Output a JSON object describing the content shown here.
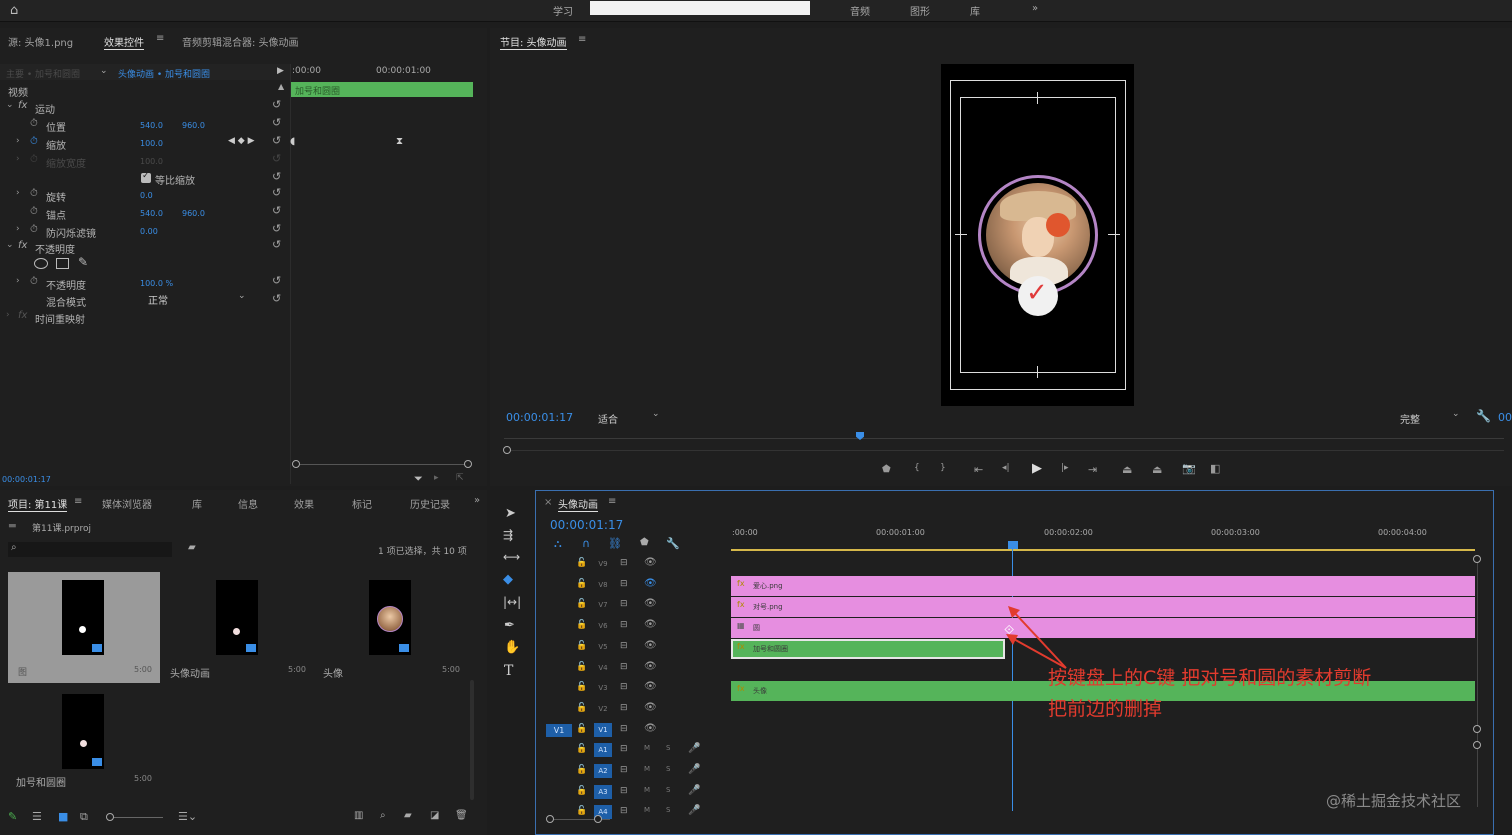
{
  "topbar": {
    "workspaces": [
      "学习",
      "音频",
      "图形",
      "库"
    ],
    "more": "»"
  },
  "effect_panel": {
    "tabs": [
      "源: 头像1.png",
      "效果控件",
      "音频剪辑混合器: 头像动画"
    ],
    "menu_icon": "≡",
    "source_path": "主要 • 加号和圆圈",
    "sequence_path": "头像动画 • 加号和圆圈",
    "ruler": {
      "start": ":00:00",
      "mark": "00:00:01:00"
    },
    "clip_name": "加号和圆圈",
    "video_label": "视频",
    "groups": [
      {
        "name": "运动",
        "fx": "fx"
      },
      {
        "name": "不透明度",
        "fx": "fx"
      },
      {
        "name": "时间重映射",
        "fx": "fx"
      }
    ],
    "props": {
      "position": {
        "label": "位置",
        "x": "540.0",
        "y": "960.0"
      },
      "scale": {
        "label": "缩放",
        "value": "100.0"
      },
      "scale_width": {
        "label": "缩放宽度",
        "value": "100.0"
      },
      "uniform_scale": "等比缩放",
      "rotation": {
        "label": "旋转",
        "value": "0.0"
      },
      "anchor": {
        "label": "锚点",
        "x": "540.0",
        "y": "960.0"
      },
      "antiflicker": {
        "label": "防闪烁滤镜",
        "value": "0.00"
      },
      "opacity": {
        "label": "不透明度",
        "value": "100.0 %"
      },
      "blend_mode": {
        "label": "混合模式",
        "value": "正常"
      }
    },
    "timecode": "00:00:01:17"
  },
  "program_monitor": {
    "title": "节目: 头像动画",
    "menu_icon": "≡",
    "timecode": "00:00:01:17",
    "fit": "适合",
    "quality": "完整",
    "end_timecode": "00"
  },
  "project_panel": {
    "tabs": [
      "项目: 第11课",
      "媒体浏览器",
      "库",
      "信息",
      "效果",
      "标记",
      "历史记录"
    ],
    "project_file": "第11课.prproj",
    "selection_info": "1 项已选择，共 10 项",
    "items": [
      {
        "name": "图",
        "duration": "5:00"
      },
      {
        "name": "头像动画",
        "duration": "5:00"
      },
      {
        "name": "头像",
        "duration": "5:00"
      },
      {
        "name": "加号和圆圈",
        "duration": "5:00"
      }
    ]
  },
  "timeline": {
    "title": "头像动画",
    "menu_icon": "≡",
    "timecode": "00:00:01:17",
    "ruler": [
      ":00:00",
      "00:00:01:00",
      "00:00:02:00",
      "00:00:03:00",
      "00:00:04:00"
    ],
    "video_tracks": [
      "V9",
      "V8",
      "V7",
      "V6",
      "V5",
      "V4",
      "V3",
      "V2",
      "V1"
    ],
    "audio_tracks": [
      "A1",
      "A2",
      "A3",
      "A4"
    ],
    "source_patch": "V1",
    "mute": "M",
    "solo": "S",
    "clips": [
      {
        "track": "V8",
        "name": "爱心.png",
        "color": "#e68ee0"
      },
      {
        "track": "V7",
        "name": "对号.png",
        "color": "#e68ee0"
      },
      {
        "track": "V6",
        "name": "圆",
        "color": "#e68ee0"
      },
      {
        "track": "V5",
        "name": "加号和圆圈",
        "color": "#55b45a"
      },
      {
        "track": "V3",
        "name": "头像",
        "color": "#55b45a"
      }
    ]
  },
  "annotation": {
    "line1": "按键盘上的C键 把对号和圆的素材剪断",
    "line2": "把前边的删掉"
  },
  "watermark": "@稀土掘金技术社区"
}
